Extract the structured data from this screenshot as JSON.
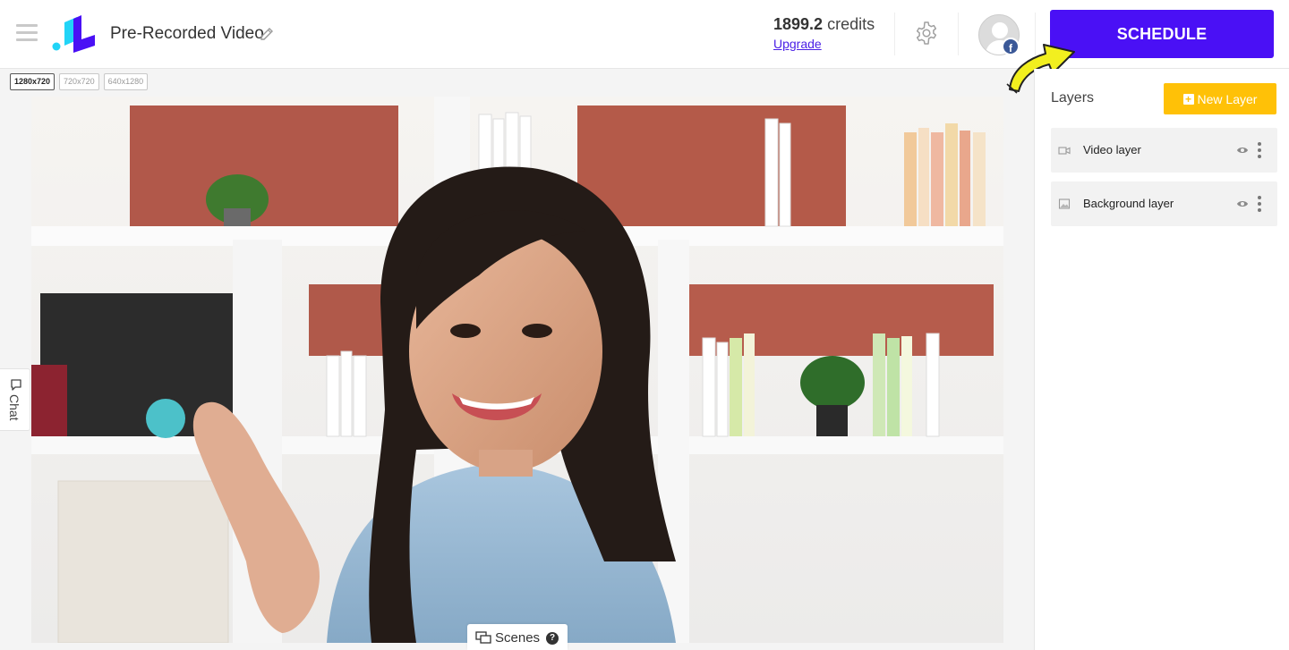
{
  "header": {
    "title": "Pre-Recorded Video",
    "credits_amount": "1899.2",
    "credits_unit": "credits",
    "upgrade_label": "Upgrade",
    "schedule_label": "SCHEDULE",
    "avatar_badge": "f"
  },
  "resolutions": {
    "options": [
      "1280x720",
      "720x720",
      "640x1280"
    ],
    "selected": "1280x720"
  },
  "chat": {
    "label": "Chat"
  },
  "scenes": {
    "label": "Scenes",
    "help": "?"
  },
  "layers_panel": {
    "title": "Layers",
    "new_layer_label": "New Layer",
    "new_layer_plus": "+",
    "items": [
      {
        "label": "Video layer",
        "icon": "video-camera-icon",
        "visible": true
      },
      {
        "label": "Background layer",
        "icon": "image-icon",
        "visible": true
      }
    ]
  },
  "colors": {
    "brand_primary": "#4a10f5",
    "new_layer_bg": "#ffc107",
    "upgrade_link": "#4a1fe6",
    "annotation_arrow": "#f2ef1f",
    "facebook": "#3b5998"
  }
}
